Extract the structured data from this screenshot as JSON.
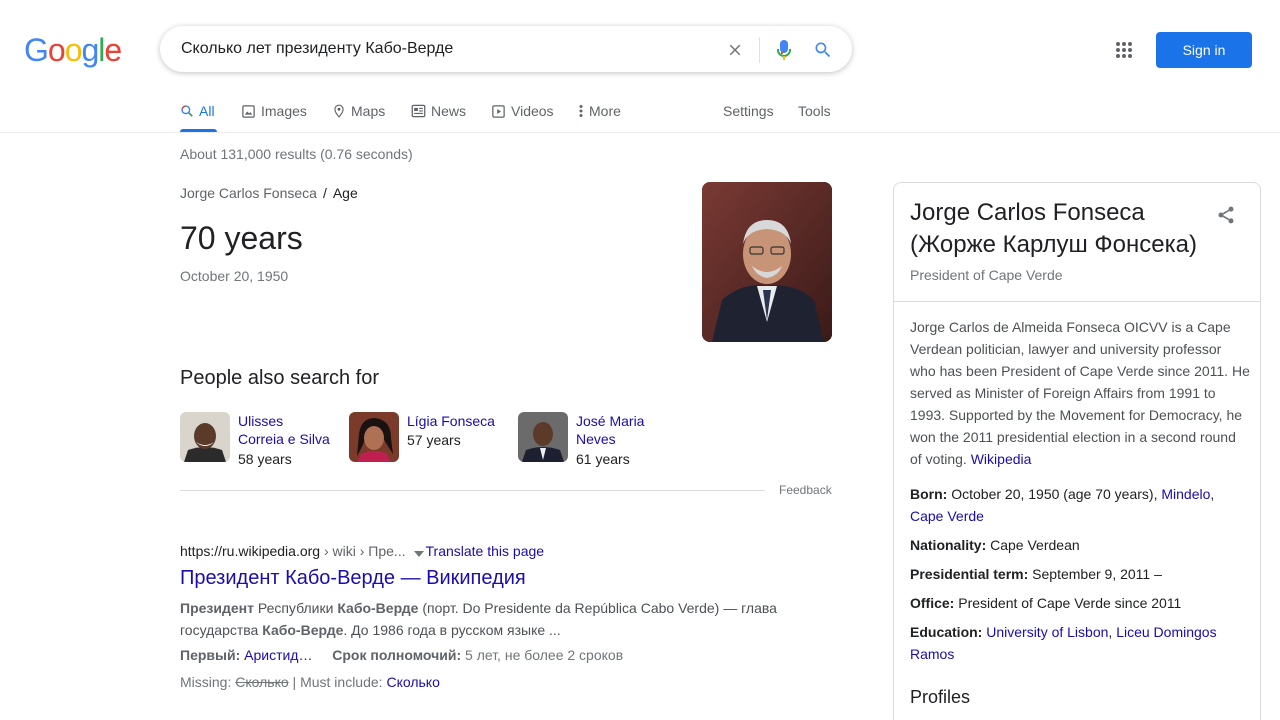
{
  "logo": {
    "letters": [
      "G",
      "o",
      "o",
      "g",
      "l",
      "e"
    ],
    "colors": [
      "#4285F4",
      "#EA4335",
      "#FBBC05",
      "#4285F4",
      "#34A853",
      "#EA4335"
    ]
  },
  "search": {
    "query": "Сколько лет президенту Кабо-Верде"
  },
  "header": {
    "sign_in_label": "Sign in"
  },
  "tabs": {
    "all": "All",
    "images": "Images",
    "maps": "Maps",
    "news": "News",
    "videos": "Videos",
    "more": "More",
    "settings": "Settings",
    "tools": "Tools"
  },
  "result_stats": "About 131,000 results (0.76 seconds)",
  "answer": {
    "entity": "Jorge Carlos Fonseca",
    "separator": "/",
    "attribute": "Age",
    "value": "70 years",
    "date": "October 20, 1950"
  },
  "people_also_search": {
    "title": "People also search for",
    "items": [
      {
        "name_line1": "Ulisses",
        "name_line2": "Correia e Silva",
        "age": "58 years"
      },
      {
        "name_line1": "Lígia Fonseca",
        "name_line2": "",
        "age": "57 years"
      },
      {
        "name_line1": "José Maria",
        "name_line2": "Neves",
        "age": "61 years"
      }
    ],
    "feedback": "Feedback"
  },
  "web_result": {
    "domain": "https://ru.wikipedia.org",
    "crumb": " › wiki › Пре...",
    "translate": "Translate this page",
    "title": "Президент Кабо-Верде — Википедия",
    "snippet_b1": "Президент",
    "snippet_t1": " Республики ",
    "snippet_b2": "Кабо-Верде",
    "snippet_t2": " (порт. Do Presidente da República Cabo Verde) — глава государства ",
    "snippet_b3": "Кабо-Верде",
    "snippet_t3": ". До 1986 года в русском языке ...",
    "attr1_label": "Первый:",
    "attr1_value": "Аристид…",
    "attr2_label": "Срок полномочий:",
    "attr2_value": "5 лет, не более 2 сроков",
    "missing_label": "Missing:",
    "missing_word": "Сколько",
    "must_include_label": "| Must include:",
    "must_include_word": "Сколько"
  },
  "knowledge_panel": {
    "title": "Jorge Carlos Fonseca (Жорже Карлуш Фонсека)",
    "subtitle": "President of Cape Verde",
    "description": "Jorge Carlos de Almeida Fonseca OICVV is a Cape Verdean politician, lawyer and university professor who has been President of Cape Verde since 2011. He served as Minister of Foreign Affairs from 1991 to 1993. Supported by the Movement for Democracy, he won the 2011 presidential election in a second round of voting.",
    "description_link": "Wikipedia",
    "facts": {
      "born_label": "Born:",
      "born_value": "October 20, 1950 (age 70 years),",
      "born_link1": "Mindelo",
      "born_link2": "Cape Verde",
      "nationality_label": "Nationality:",
      "nationality_value": "Cape Verdean",
      "term_label": "Presidential term:",
      "term_value": "September 9, 2011 –",
      "office_label": "Office:",
      "office_value": "President of Cape Verde since 2011",
      "education_label": "Education:",
      "education_link1": "University of Lisbon",
      "education_link2": "Liceu Domingos Ramos"
    },
    "profiles": "Profiles"
  }
}
